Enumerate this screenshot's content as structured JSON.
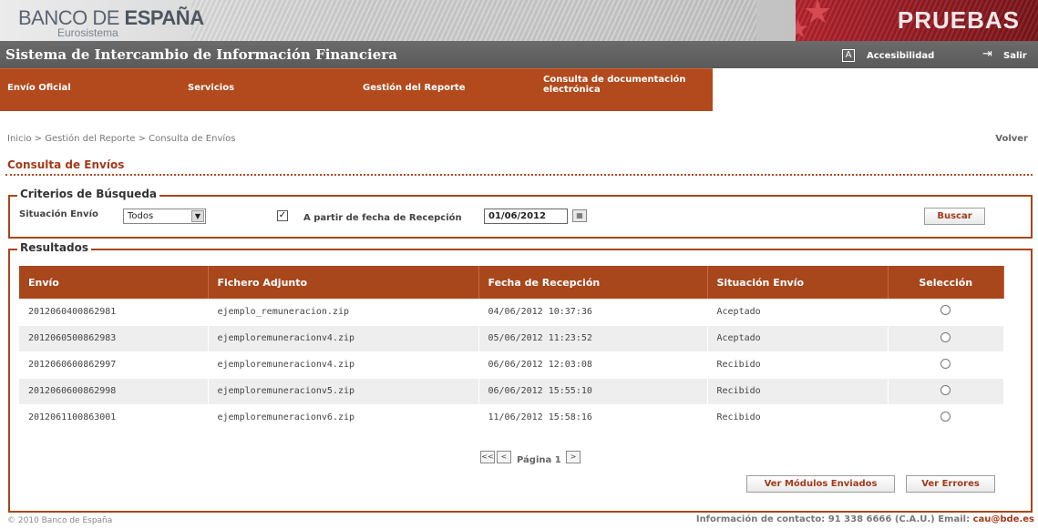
{
  "header": {
    "logo_part1": "BANCO DE ",
    "logo_part2": "ESPAÑA",
    "logo_sub": "Eurosistema",
    "environment": "PRUEBAS"
  },
  "titlebar": {
    "title": "Sistema de Intercambio de Información Financiera",
    "accessibility_icon": "A",
    "accessibility_label": "Accesibilidad",
    "exit_label": "Salir"
  },
  "nav": {
    "items": [
      {
        "label": "Envío Oficial"
      },
      {
        "label": "Servicios"
      },
      {
        "label": "Gestión del Reporte"
      },
      {
        "label": "Consulta de documentación electrónica"
      }
    ]
  },
  "breadcrumb": "Inicio > Gestión del Reporte > Consulta de Envíos",
  "back_label": "Volver",
  "page_title": "Consulta de Envíos",
  "search": {
    "legend": "Criterios de Búsqueda",
    "status_label": "Situación Envío",
    "status_value": "Todos",
    "date_checkbox_checked": true,
    "date_label": "A partir de fecha de Recepción",
    "date_value": "01/06/2012",
    "search_button": "Buscar"
  },
  "results": {
    "legend": "Resultados",
    "columns": [
      "Envío",
      "Fichero Adjunto",
      "Fecha de Recepción",
      "Situación Envío",
      "Selección"
    ],
    "rows": [
      {
        "envio": "2012060400862981",
        "fichero": "ejemplo_remuneracion.zip",
        "fecha": "04/06/2012 10:37:36",
        "situacion": "Aceptado"
      },
      {
        "envio": "2012060500862983",
        "fichero": "ejemploremuneracionv4.zip",
        "fecha": "05/06/2012 11:23:52",
        "situacion": "Aceptado"
      },
      {
        "envio": "2012060600862997",
        "fichero": "ejemploremuneracionv4.zip",
        "fecha": "06/06/2012 12:03:08",
        "situacion": "Recibido"
      },
      {
        "envio": "2012060600862998",
        "fichero": "ejemploremuneracionv5.zip",
        "fecha": "06/06/2012 15:55:10",
        "situacion": "Recibido"
      },
      {
        "envio": "2012061100863001",
        "fichero": "ejemploremuneracionv6.zip",
        "fecha": "11/06/2012 15:58:16",
        "situacion": "Recibido"
      }
    ],
    "pager": {
      "first": "<<",
      "prev": "<",
      "label": "Página 1",
      "next": ">"
    },
    "modules_button": "Ver Módulos Enviados",
    "errors_button": "Ver Errores"
  },
  "footer": {
    "copyright": "© 2010 Banco de España",
    "contact": "Información de contacto: 91 338 6666 (C.A.U.) Email: ",
    "email": "cau@bde.es"
  },
  "colors": {
    "accent": "#a8461c",
    "title_bar": "#5f5f5f",
    "pruebas_red": "#9e1f26"
  }
}
